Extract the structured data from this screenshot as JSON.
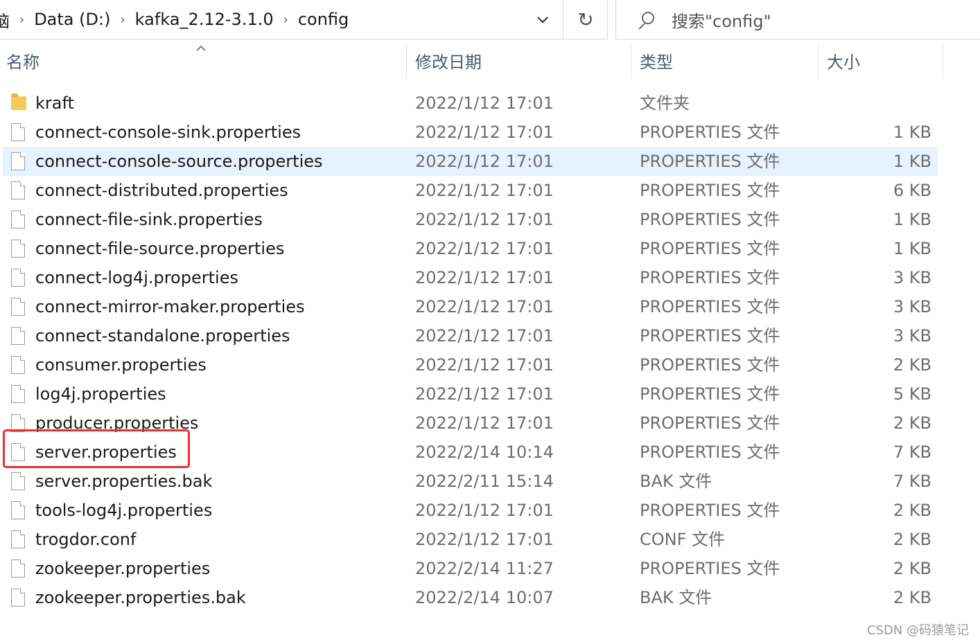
{
  "address": {
    "first_crumb": "脑",
    "crumbs": [
      "Data (D:)",
      "kafka_2.12-3.1.0",
      "config"
    ]
  },
  "search": {
    "placeholder": "搜索\"config\""
  },
  "columns": {
    "name": "名称",
    "date": "修改日期",
    "type": "类型",
    "size": "大小"
  },
  "files": [
    {
      "name": "kraft",
      "date": "2022/1/12 17:01",
      "type": "文件夹",
      "size": "",
      "icon": "folder-icon"
    },
    {
      "name": "connect-console-sink.properties",
      "date": "2022/1/12 17:01",
      "type": "PROPERTIES 文件",
      "size": "1 KB",
      "icon": "file-icon"
    },
    {
      "name": "connect-console-source.properties",
      "date": "2022/1/12 17:01",
      "type": "PROPERTIES 文件",
      "size": "1 KB",
      "icon": "file-icon"
    },
    {
      "name": "connect-distributed.properties",
      "date": "2022/1/12 17:01",
      "type": "PROPERTIES 文件",
      "size": "6 KB",
      "icon": "file-icon"
    },
    {
      "name": "connect-file-sink.properties",
      "date": "2022/1/12 17:01",
      "type": "PROPERTIES 文件",
      "size": "1 KB",
      "icon": "file-icon"
    },
    {
      "name": "connect-file-source.properties",
      "date": "2022/1/12 17:01",
      "type": "PROPERTIES 文件",
      "size": "1 KB",
      "icon": "file-icon"
    },
    {
      "name": "connect-log4j.properties",
      "date": "2022/1/12 17:01",
      "type": "PROPERTIES 文件",
      "size": "3 KB",
      "icon": "file-icon"
    },
    {
      "name": "connect-mirror-maker.properties",
      "date": "2022/1/12 17:01",
      "type": "PROPERTIES 文件",
      "size": "3 KB",
      "icon": "file-icon"
    },
    {
      "name": "connect-standalone.properties",
      "date": "2022/1/12 17:01",
      "type": "PROPERTIES 文件",
      "size": "3 KB",
      "icon": "file-icon"
    },
    {
      "name": "consumer.properties",
      "date": "2022/1/12 17:01",
      "type": "PROPERTIES 文件",
      "size": "2 KB",
      "icon": "file-icon"
    },
    {
      "name": "log4j.properties",
      "date": "2022/1/12 17:01",
      "type": "PROPERTIES 文件",
      "size": "5 KB",
      "icon": "file-icon"
    },
    {
      "name": "producer.properties",
      "date": "2022/1/12 17:01",
      "type": "PROPERTIES 文件",
      "size": "2 KB",
      "icon": "file-icon"
    },
    {
      "name": "server.properties",
      "date": "2022/2/14 10:14",
      "type": "PROPERTIES 文件",
      "size": "7 KB",
      "icon": "file-icon"
    },
    {
      "name": "server.properties.bak",
      "date": "2022/2/11 15:14",
      "type": "BAK 文件",
      "size": "7 KB",
      "icon": "file-icon"
    },
    {
      "name": "tools-log4j.properties",
      "date": "2022/1/12 17:01",
      "type": "PROPERTIES 文件",
      "size": "2 KB",
      "icon": "file-icon"
    },
    {
      "name": "trogdor.conf",
      "date": "2022/1/12 17:01",
      "type": "CONF 文件",
      "size": "2 KB",
      "icon": "file-icon"
    },
    {
      "name": "zookeeper.properties",
      "date": "2022/2/14 11:27",
      "type": "PROPERTIES 文件",
      "size": "2 KB",
      "icon": "file-icon"
    },
    {
      "name": "zookeeper.properties.bak",
      "date": "2022/2/14 10:07",
      "type": "BAK 文件",
      "size": "2 KB",
      "icon": "file-icon"
    }
  ],
  "hovered_row_index": 2,
  "annotated_row_index": 12,
  "annotation_color": "#e8302a",
  "watermark": "CSDN @码猿笔记"
}
